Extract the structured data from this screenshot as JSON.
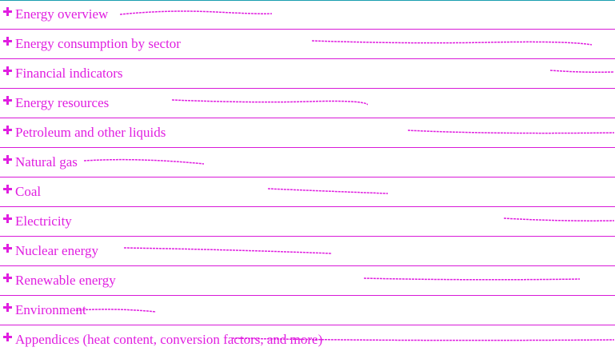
{
  "colors": {
    "accent": "#e01ee0",
    "rule": "#d81ad8",
    "top_rule": "#1a9fb0"
  },
  "icons": {
    "expand": "plus-icon"
  },
  "sections": [
    {
      "label": "Energy overview"
    },
    {
      "label": "Energy consumption by sector"
    },
    {
      "label": "Financial indicators"
    },
    {
      "label": "Energy resources"
    },
    {
      "label": "Petroleum and other liquids"
    },
    {
      "label": "Natural gas"
    },
    {
      "label": "Coal"
    },
    {
      "label": "Electricity"
    },
    {
      "label": "Nuclear energy"
    },
    {
      "label": "Renewable energy"
    },
    {
      "label": "Environment"
    },
    {
      "label": "Appendices (heat content, conversion factors, and more)"
    }
  ]
}
